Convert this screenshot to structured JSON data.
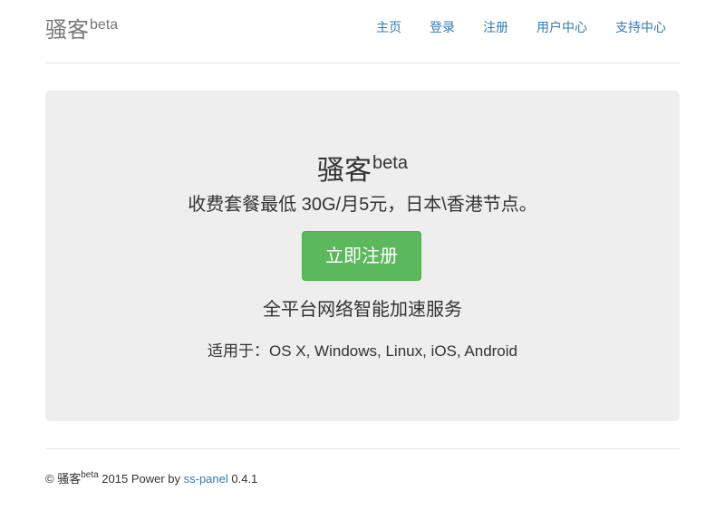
{
  "header": {
    "brand_name": "骚客",
    "brand_sup": "beta",
    "nav": [
      {
        "label": "主页"
      },
      {
        "label": "登录"
      },
      {
        "label": "注册"
      },
      {
        "label": "用户中心"
      },
      {
        "label": "支持中心"
      }
    ]
  },
  "hero": {
    "title": "骚客",
    "title_sup": "beta",
    "lead": "收费套餐最低 30G/月5元，日本\\香港节点。",
    "register_button": "立即注册",
    "subtitle": "全平台网络智能加速服务",
    "platforms": "适用于：OS X, Windows, Linux, iOS, Android"
  },
  "footer": {
    "copyright": "© 骚客",
    "brand_sup": "beta",
    "year_power": " 2015 Power by ",
    "link_text": "ss-panel",
    "version": " 0.4.1"
  },
  "colors": {
    "link": "#337ab7",
    "success": "#5cb85c",
    "jumbotron_bg": "#eeeeee"
  }
}
